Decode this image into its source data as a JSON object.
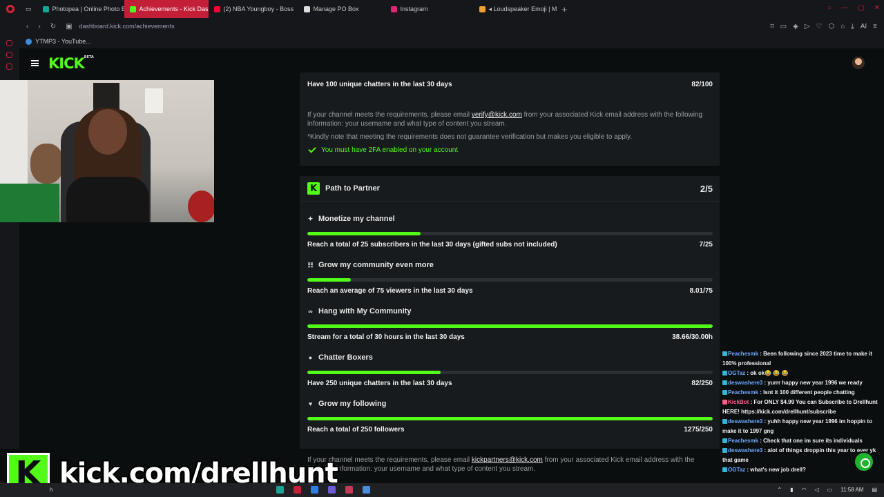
{
  "browser": {
    "tabs": [
      {
        "label": "Photopea | Online Photo E",
        "color": "#18a497"
      },
      {
        "label": "Achievements - Kick Dash",
        "color": "#53fc18",
        "active": true
      },
      {
        "label": "(2) NBA Youngboy - Boss",
        "color": "#ff0033"
      },
      {
        "label": "Manage PO Box",
        "color": "#dddddd"
      },
      {
        "label": "Instagram",
        "color": "#d62976"
      },
      {
        "label": "◂ Loudspeaker Emoji | M",
        "color": "#f0a030"
      }
    ],
    "url": "dashboard.kick.com/achievements",
    "bookmark": "YTMP3 - YouTube...",
    "ai_label": "AI"
  },
  "kick": {
    "logo": "KICK",
    "logo_badge": "BETA"
  },
  "verification": {
    "requirement": {
      "label": "Have 100 unique chatters in the last 30 days",
      "value": "82/100"
    },
    "note_prefix": "If your channel meets the requirements, please email ",
    "note_email": "verify@kick.com",
    "note_suffix": " from your associated Kick email address with the following information: your username and what type of content you stream.",
    "disclaimer": "*Kindly note that meeting the requirements does not guarantee verification but makes you eligible to apply.",
    "twofa": "You must have 2FA enabled on your account"
  },
  "partner": {
    "title": "Path to Partner",
    "count": "2/5",
    "items": [
      {
        "title": "Monetize my channel",
        "icon": "sparkle-icon",
        "glyph": "✦",
        "label": "Reach a total of 25 subscribers in the last 30 days (gifted subs not included)",
        "value": "7/25",
        "progress": 0.28
      },
      {
        "title": "Grow my community even more",
        "icon": "people-icon",
        "glyph": "☷",
        "label": "Reach an average of 75 viewers in the last 30 days",
        "value": "8.01/75",
        "progress": 0.107
      },
      {
        "title": "Hang with My Community",
        "icon": "glasses-icon",
        "glyph": "∞",
        "label": "Stream for a total of 30 hours in the last 30 days",
        "value": "38.66/30.00h",
        "progress": 1.0
      },
      {
        "title": "Chatter Boxers",
        "icon": "chat-bubble-icon",
        "glyph": "●",
        "label": "Have 250 unique chatters in the last 30 days",
        "value": "82/250",
        "progress": 0.328
      },
      {
        "title": "Grow my following",
        "icon": "heart-icon",
        "glyph": "♥",
        "label": "Reach a total of 250 followers",
        "value": "1275/250",
        "progress": 1.0
      }
    ],
    "note_prefix": "If your channel meets the requirements, please email ",
    "note_email": "kickpartners@kick.com",
    "note_suffix": " from your associated Kick email address with the following information: your username and what type of content you stream."
  },
  "chat": [
    {
      "user": "Peachesmk",
      "text": "Been following since 2023 time to make it 100% professional"
    },
    {
      "user": "OGTaz",
      "text": "ok ok😂 😂 😂"
    },
    {
      "user": "deswashere3",
      "text": "yurrr happy new year 1996 we ready"
    },
    {
      "user": "Peachesmk",
      "text": "Isnt it 100 different people chatting"
    },
    {
      "user": "KickBot",
      "text": "For ONLY $4.99 You can Subscribe to Drellhunt HERE! https://kick.com/drellhunt/subscribe",
      "pink": true
    },
    {
      "user": "deswashere3",
      "text": "yuhh happy new year 1996 im hoppin to make it to 1997 gng"
    },
    {
      "user": "Peachesmk",
      "text": "Check that one im sure its individuals"
    },
    {
      "user": "deswashere3",
      "text": "alot of things droppin this year to ever yk that game"
    },
    {
      "user": "OGTaz",
      "text": "what's new job drell?"
    }
  ],
  "overlay": {
    "logo": "K",
    "text": "kick.com/drellhunt"
  },
  "taskbar": {
    "search": "h",
    "time": "11:58 AM"
  },
  "colors": {
    "accent": "#53fc18",
    "tab_active": "#c41f38",
    "card_bg": "#181b1d"
  }
}
